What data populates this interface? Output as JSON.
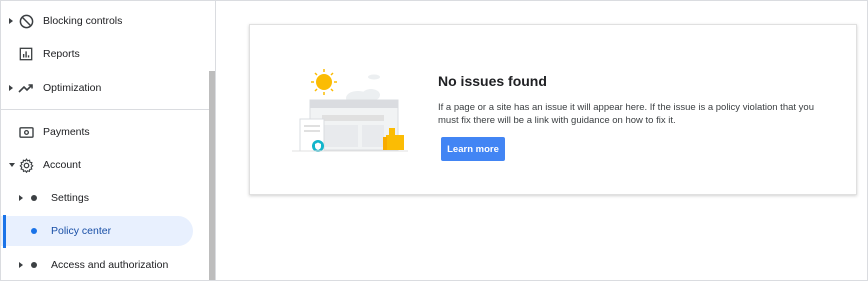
{
  "sidebar": {
    "items": [
      {
        "label": "Blocking controls",
        "icon": "block-icon",
        "has_caret": true
      },
      {
        "label": "Reports",
        "icon": "reports-icon",
        "has_caret": false
      },
      {
        "label": "Optimization",
        "icon": "trending-up-icon",
        "has_caret": true
      },
      {
        "label": "Payments",
        "icon": "payments-icon",
        "has_caret": false
      },
      {
        "label": "Account",
        "icon": "gear-icon",
        "has_caret": true,
        "expanded": true
      }
    ],
    "subitems": [
      {
        "label": "Settings",
        "has_caret": true,
        "active": false
      },
      {
        "label": "Policy center",
        "has_caret": false,
        "active": true
      },
      {
        "label": "Access and authorization",
        "has_caret": true,
        "active": false
      }
    ]
  },
  "card": {
    "title": "No issues found",
    "body": "If a page or a site has an issue it will appear here. If the issue is a policy violation that you must fix there will be a link with guidance on how to fix it.",
    "button_label": "Learn more",
    "illustration": "no-issues-illustration"
  },
  "colors": {
    "accent": "#1a73e8",
    "button": "#4285f4",
    "active_bg": "#e8f0fe",
    "sun": "#fbbc04",
    "badge": "#12b5cb"
  }
}
